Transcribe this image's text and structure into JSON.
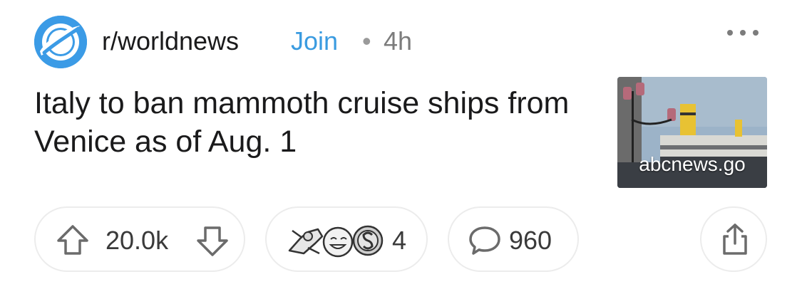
{
  "post": {
    "subreddit": "r/worldnews",
    "join_label": "Join",
    "separator": "•",
    "age": "4h",
    "title": "Italy to ban mammoth cruise ships from Venice as of Aug. 1",
    "thumbnail_domain": "abcnews.go"
  },
  "actions": {
    "score": "20.0k",
    "award_count": "4",
    "comment_count": "960"
  },
  "colors": {
    "join": "#3a9be0",
    "subreddit_avatar": "#3b9be6",
    "muted_text": "#7c7c7c",
    "pill_border": "#ececec"
  },
  "icons": {
    "subreddit_avatar": "planet-orbit-icon",
    "more": "more-options-icon",
    "upvote": "upvote-arrow-icon",
    "downvote": "downvote-arrow-icon",
    "awards": [
      "arm-wrestle-award-icon",
      "grinning-face-award-icon",
      "silver-award-icon"
    ],
    "comment": "comment-bubble-icon",
    "share": "share-icon"
  }
}
